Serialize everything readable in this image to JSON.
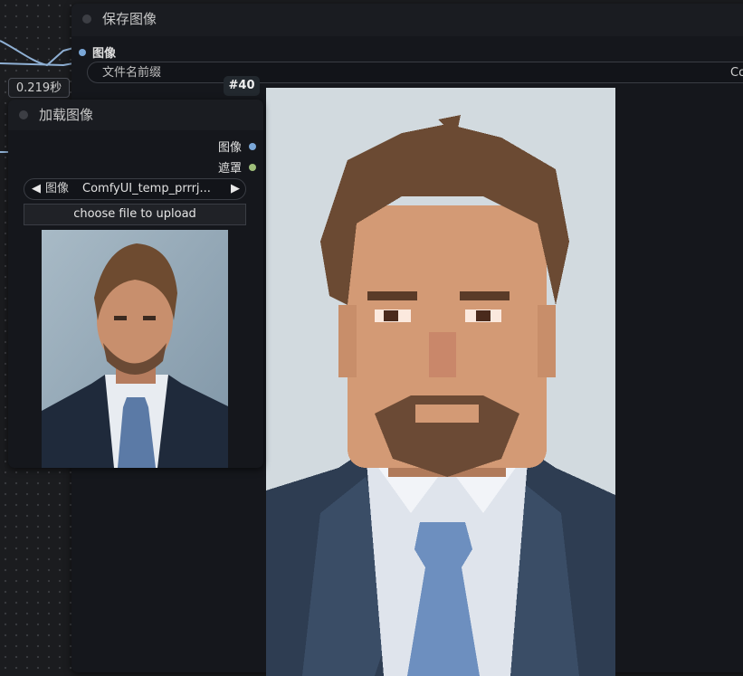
{
  "save_node": {
    "title": "保存图像",
    "input_label": "图像",
    "prefix_label": "文件名前缀",
    "prefix_value": "Co"
  },
  "exec_time": "0.219秒",
  "node_id": "#40",
  "load_node": {
    "title": "加载图像",
    "outputs": [
      "图像",
      "遮罩"
    ],
    "image_combo": {
      "label": "图像",
      "value": "ComfyUI_temp_prrrj..."
    },
    "upload_label": "choose file to upload"
  },
  "colors": {
    "canvas": "#1b1c1f",
    "node_body": "#15171c",
    "image_slot": "#7aa7d8",
    "mask_slot": "#9fbf7a",
    "wire": "#8fb0d4"
  }
}
